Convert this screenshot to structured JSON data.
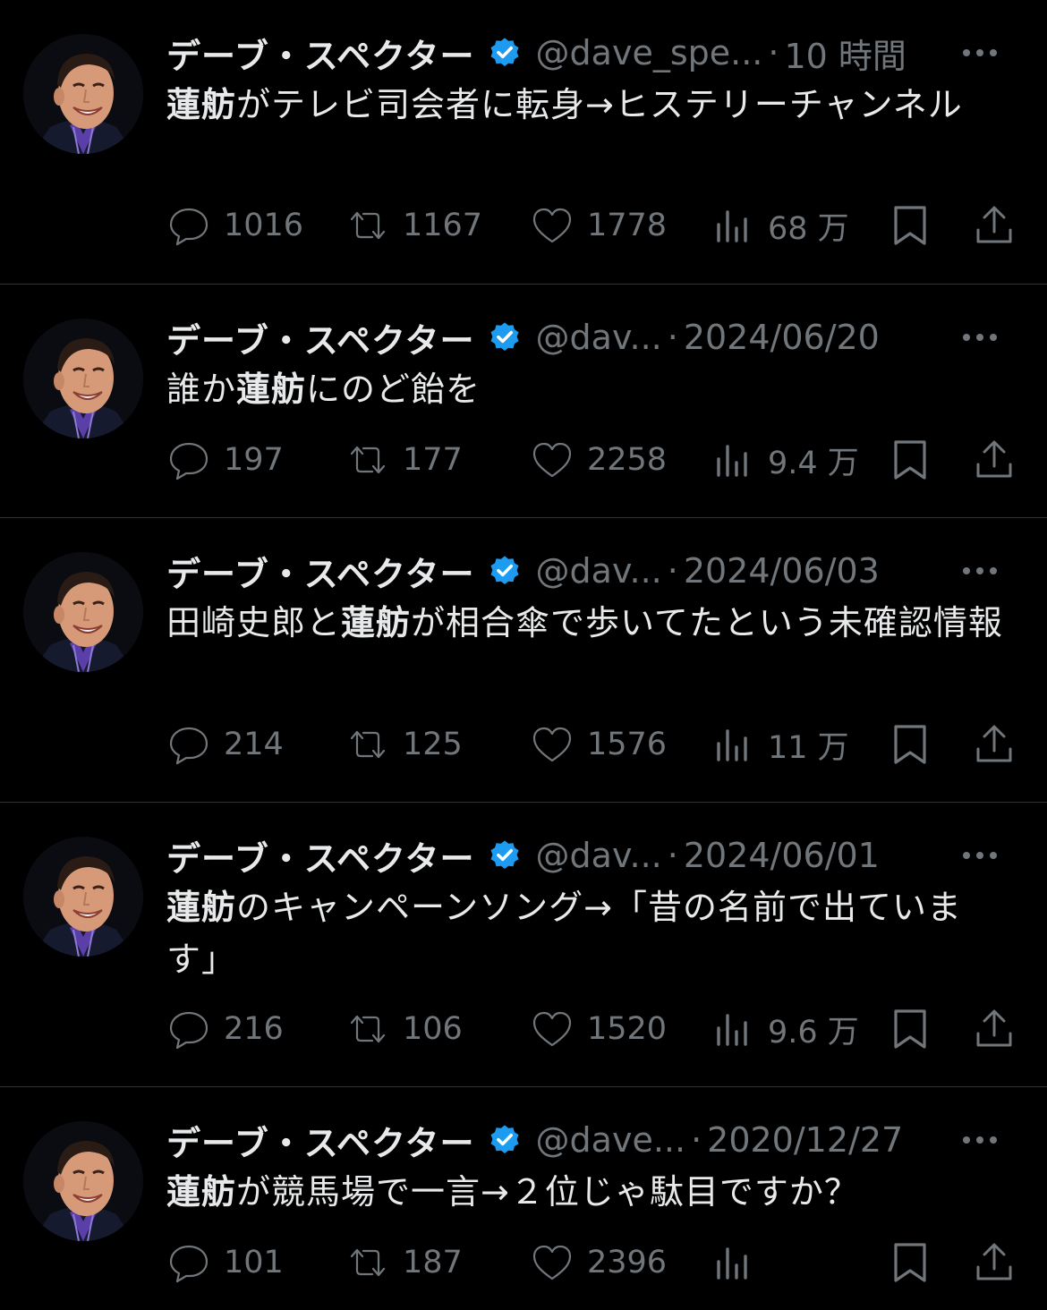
{
  "colors": {
    "background": "#000000",
    "text": "#e7e9ea",
    "muted": "#71767b",
    "verified": "#1d9bf0",
    "divider": "#2f3336"
  },
  "tweets": [
    {
      "name": "デーブ・スペクター",
      "handle": "@dave_spe...",
      "separator": "·",
      "time": "10 時間",
      "text_bold": "蓮舫",
      "text_pre": "",
      "text_rest": "がテレビ司会者に転身→ヒステリーチャンネル",
      "replies": "1016",
      "retweets": "1167",
      "likes": "1778",
      "views": "68 万"
    },
    {
      "name": "デーブ・スペクター",
      "handle": "@dav...",
      "separator": "·",
      "time": "2024/06/20",
      "text_bold": "蓮舫",
      "text_pre": "誰か",
      "text_rest": "にのど飴を",
      "replies": "197",
      "retweets": "177",
      "likes": "2258",
      "views": "9.4 万"
    },
    {
      "name": "デーブ・スペクター",
      "handle": "@dav...",
      "separator": "·",
      "time": "2024/06/03",
      "text_bold": "蓮舫",
      "text_pre": "田崎史郎と",
      "text_rest": "が相合傘で歩いてたという未確認情報",
      "replies": "214",
      "retweets": "125",
      "likes": "1576",
      "views": "11 万"
    },
    {
      "name": "デーブ・スペクター",
      "handle": "@dav...",
      "separator": "·",
      "time": "2024/06/01",
      "text_bold": "蓮舫",
      "text_pre": "",
      "text_rest": "のキャンペーンソング→「昔の名前で出ています」",
      "replies": "216",
      "retweets": "106",
      "likes": "1520",
      "views": "9.6 万"
    },
    {
      "name": "デーブ・スペクター",
      "handle": "@dave...",
      "separator": "·",
      "time": "2020/12/27",
      "text_bold": "蓮舫",
      "text_pre": "",
      "text_rest": "が競馬場で一言→２位じゃ駄目ですか？",
      "replies": "101",
      "retweets": "187",
      "likes": "2396",
      "views": ""
    }
  ]
}
